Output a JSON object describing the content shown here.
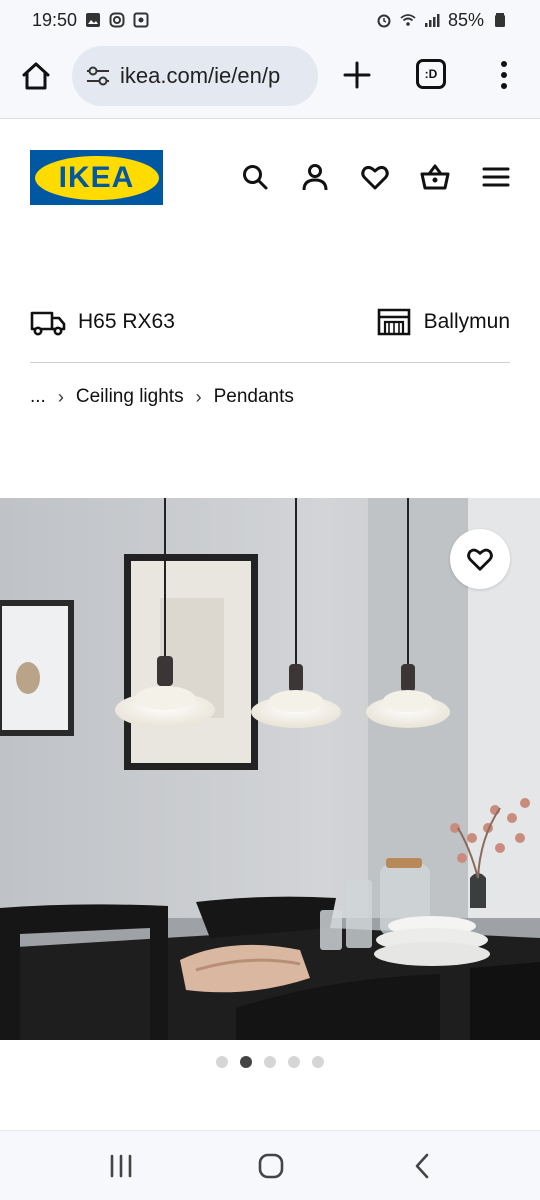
{
  "status_bar": {
    "time": "19:50",
    "battery": "85%"
  },
  "browser": {
    "url": "ikea.com/ie/en/p",
    "tabs_label": ":D"
  },
  "header": {
    "logo_text": "IKEA"
  },
  "location": {
    "postcode": "H65 RX63",
    "store": "Ballymun"
  },
  "breadcrumb": {
    "ellipsis": "...",
    "items": [
      "Ceiling lights",
      "Pendants"
    ]
  },
  "carousel": {
    "total": 5,
    "active_index": 1
  },
  "colors": {
    "ikea_blue": "#0058a3",
    "ikea_yellow": "#ffdb00"
  }
}
